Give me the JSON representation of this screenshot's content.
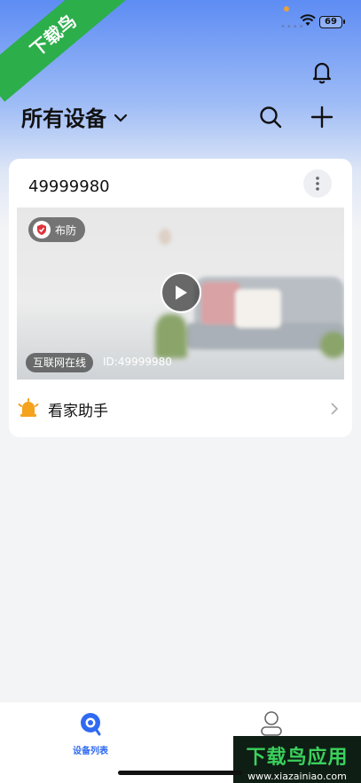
{
  "status_bar": {
    "battery": "69"
  },
  "watermark": {
    "corner": "下载鸟",
    "main": "下载鸟应用",
    "url": "www.xiazainiao.com"
  },
  "header": {
    "title": "所有设备"
  },
  "device": {
    "name": "49999980",
    "arm_status": "布防",
    "online_status": "互联网在线",
    "id_label": "ID:49999980",
    "assistant_label": "看家助手"
  },
  "tab_bar": {
    "devices_label": "设备列表"
  },
  "colors": {
    "accent": "#2f6af2",
    "alert_orange": "#f5a21d",
    "arm_red": "#e0323a"
  }
}
